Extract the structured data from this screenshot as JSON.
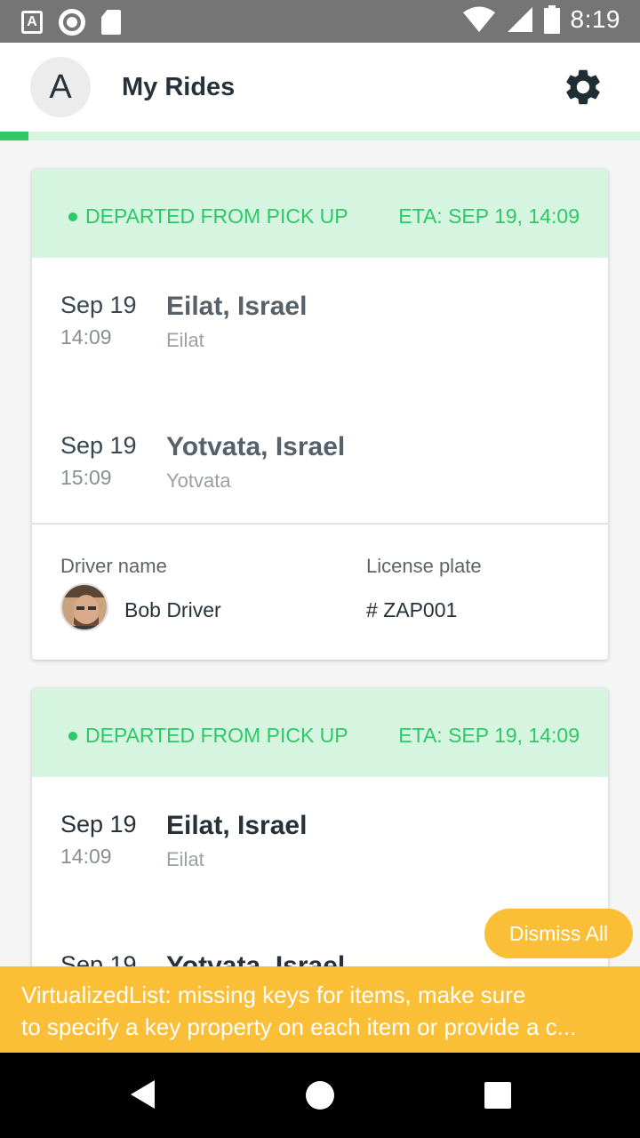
{
  "status_bar": {
    "time": "8:19"
  },
  "header": {
    "avatar_letter": "A",
    "title": "My Rides"
  },
  "progress": {
    "fraction": 0.044
  },
  "rides": [
    {
      "status": "DEPARTED FROM PICK UP",
      "eta": "ETA: SEP 19, 14:09",
      "pickup": {
        "date": "Sep 19",
        "time": "14:09",
        "city": "Eilat, Israel",
        "sub": "Eilat"
      },
      "dropoff": {
        "date": "Sep 19",
        "time": "15:09",
        "city": "Yotvata, Israel",
        "sub": "Yotvata"
      },
      "driver_label": "Driver name",
      "driver_name": "Bob  Driver",
      "plate_label": "License plate",
      "plate_value": "# ZAP001"
    },
    {
      "status": "DEPARTED FROM PICK UP",
      "eta": "ETA: SEP 19, 14:09",
      "pickup": {
        "date": "Sep 19",
        "time": "14:09",
        "city": "Eilat, Israel",
        "sub": "Eilat"
      },
      "dropoff": {
        "date": "Sep 19",
        "time": "",
        "city": "Yotvata, Israel",
        "sub": ""
      }
    }
  ],
  "yellowbox": {
    "dismiss_label": "Dismiss All",
    "line1": "VirtualizedList: missing keys for items, make sure",
    "line2": "to specify a key property on each item or provide a c..."
  },
  "colors": {
    "accent": "#2ec866",
    "status_bg": "#d6f5e1",
    "warning": "#fbbe37"
  }
}
